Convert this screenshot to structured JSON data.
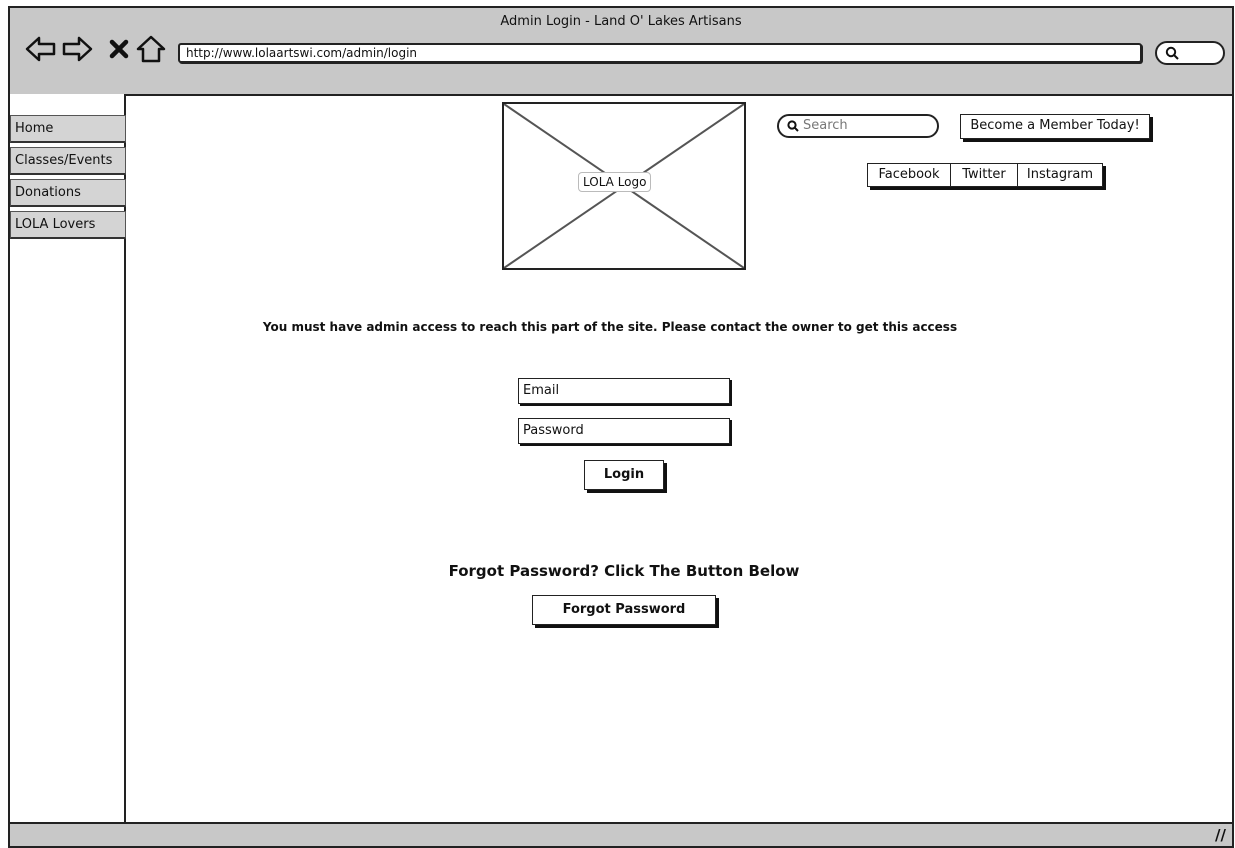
{
  "window": {
    "title": "Admin Login - Land O' Lakes Artisans"
  },
  "browser": {
    "url": "http://www.lolaartswi.com/admin/login",
    "nav_icons": [
      "back-arrow-icon",
      "forward-arrow-icon",
      "stop-icon",
      "home-icon",
      "search-icon"
    ]
  },
  "sidebar": {
    "items": [
      {
        "label": "Home"
      },
      {
        "label": "Classes/Events"
      },
      {
        "label": "Donations"
      },
      {
        "label": "LOLA Lovers"
      }
    ]
  },
  "header": {
    "logo_label": "LOLA Logo",
    "search_placeholder": "Search",
    "member_button": "Become a Member Today!",
    "social": {
      "facebook": "Facebook",
      "twitter": "Twitter",
      "instagram": "Instagram"
    }
  },
  "main": {
    "notice": "You must have admin access to reach this part of the site. Please contact the owner to get this access",
    "email_placeholder": "Email",
    "password_placeholder": "Password",
    "login_button": "Login",
    "forgot_heading": "Forgot Password? Click The Button Below",
    "forgot_button": "Forgot Password"
  },
  "colors": {
    "chrome": "#c8c8c8",
    "sidebar_item": "#d4d4d4",
    "ink": "#222222"
  }
}
